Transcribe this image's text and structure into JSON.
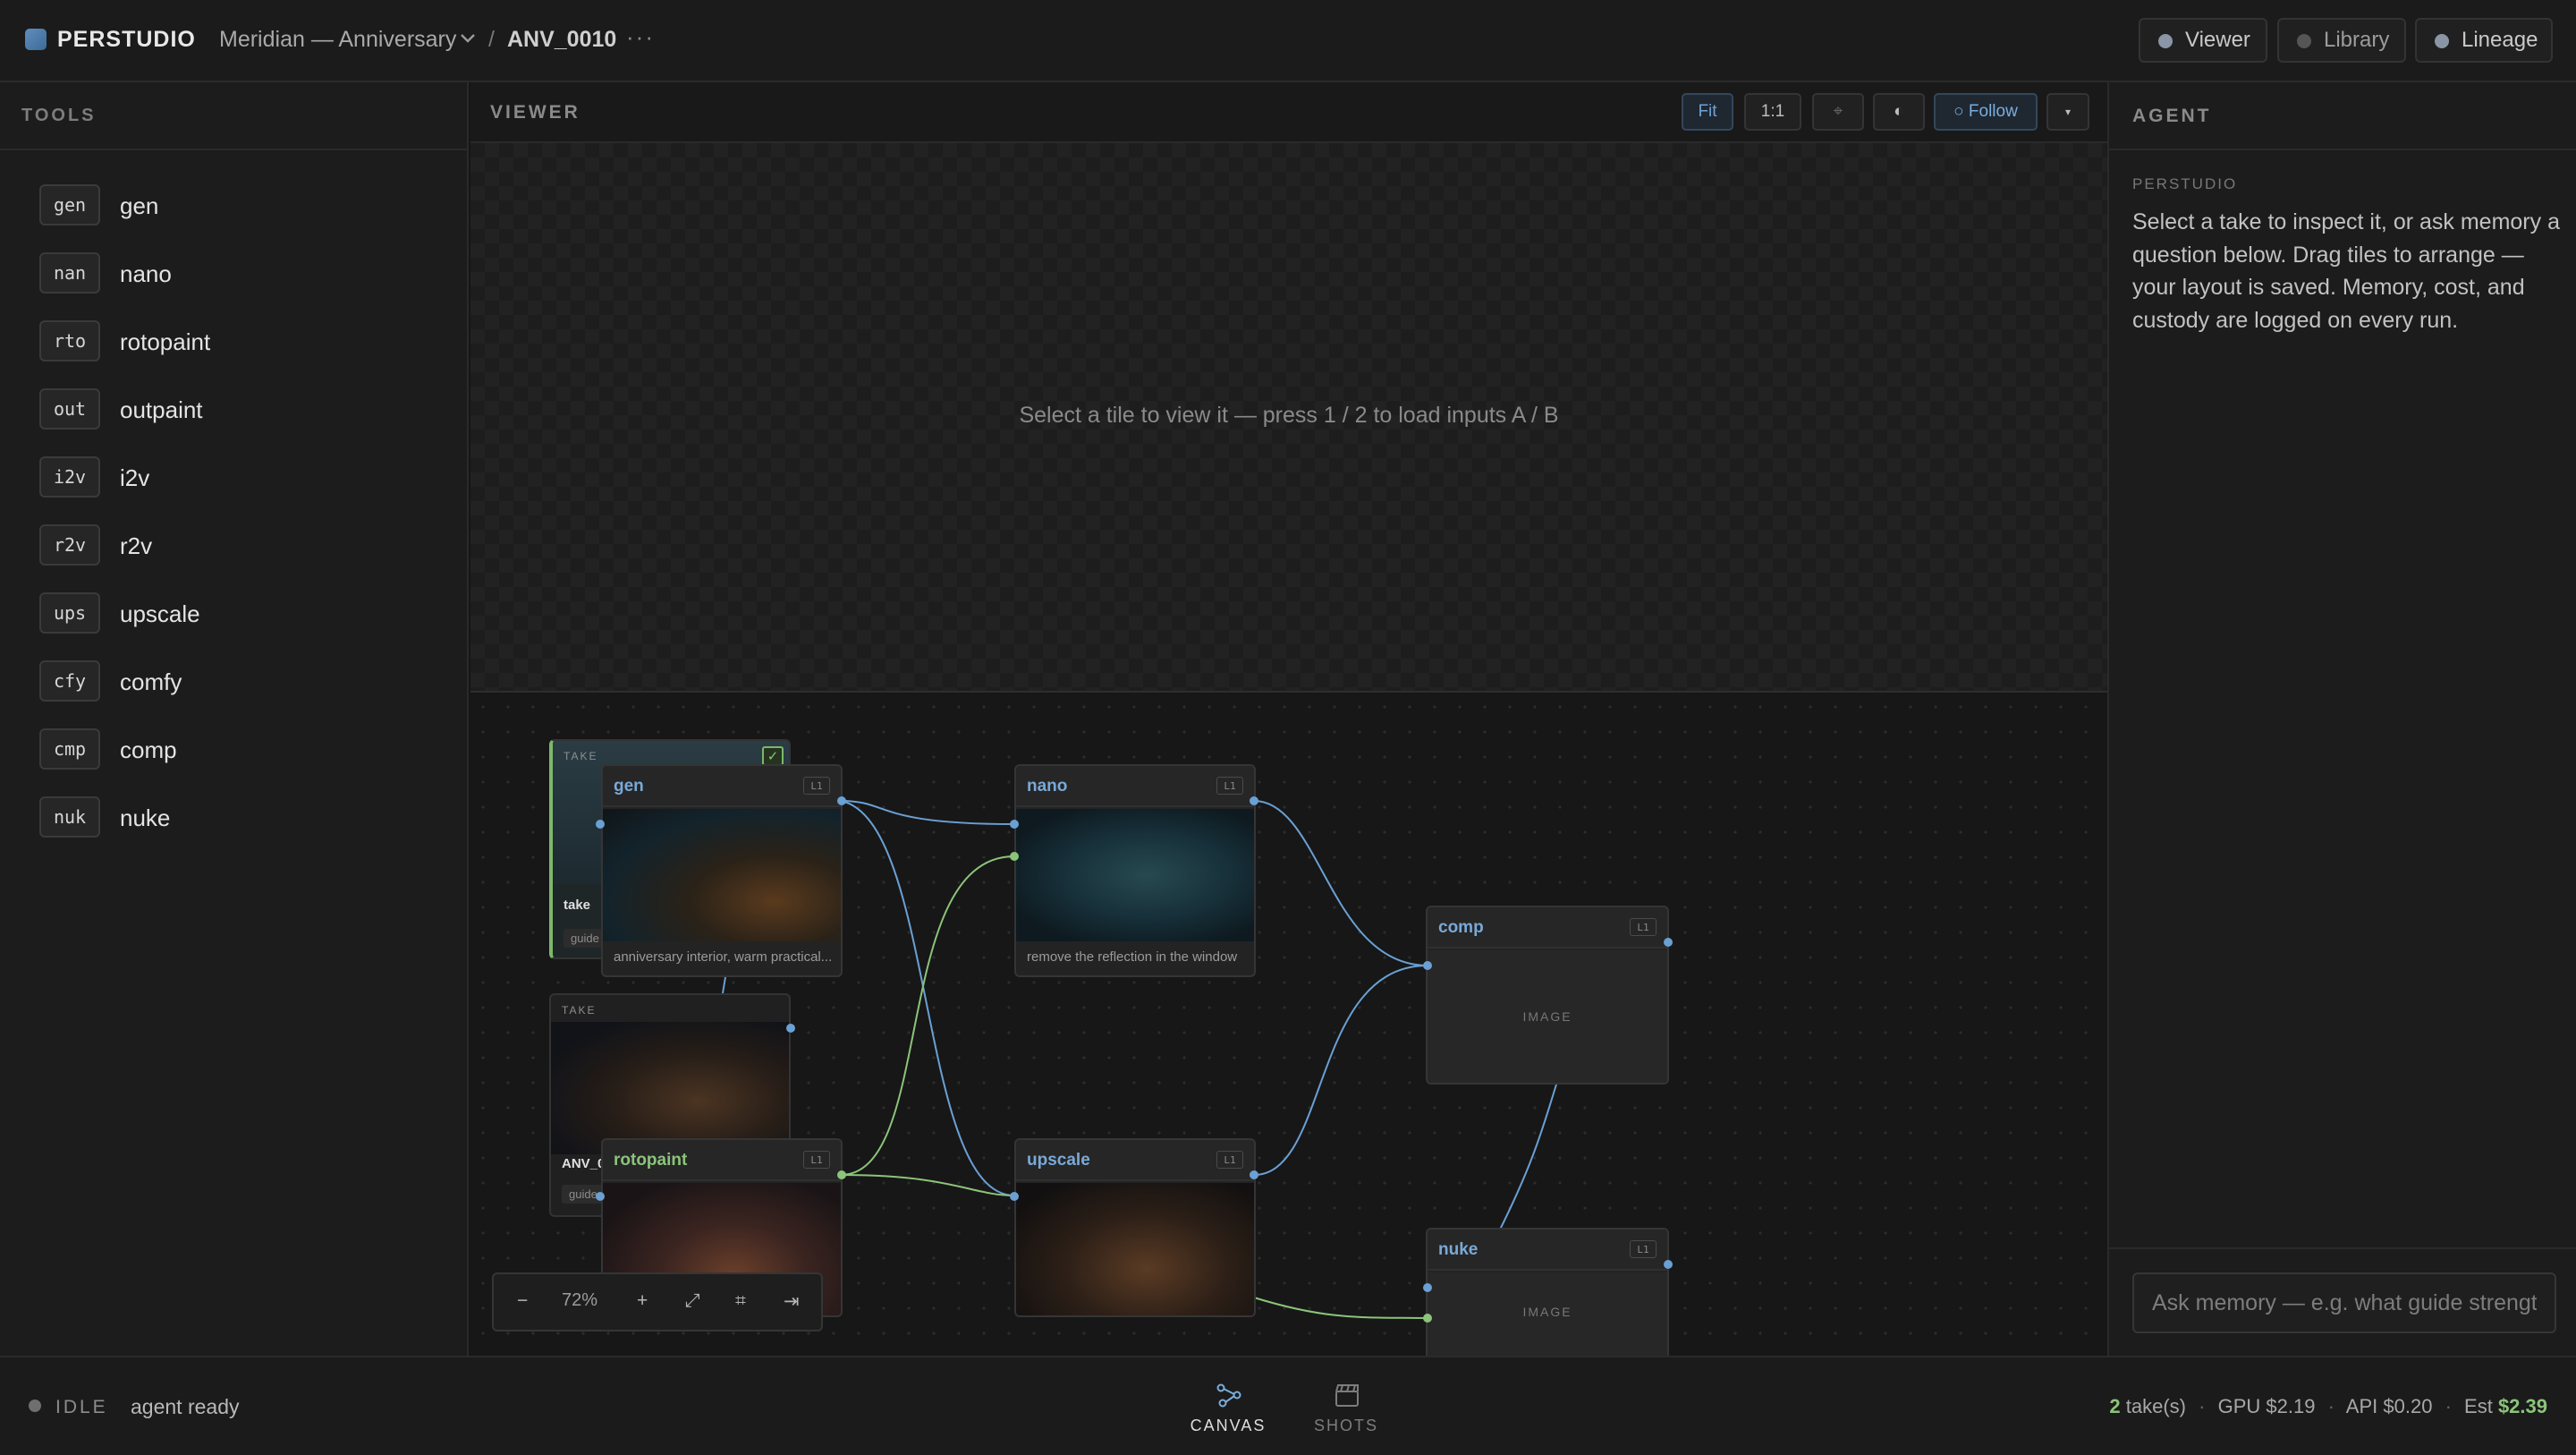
{
  "brand": {
    "name": "PERSTUDIO",
    "accent": "#4f83b8"
  },
  "breadcrumb": {
    "project": "Meridian — Anniversary",
    "separator": "/",
    "shot": "ANV_0010",
    "more": "···"
  },
  "top_tabs": [
    {
      "label": "Viewer"
    },
    {
      "label": "Library"
    },
    {
      "label": "Lineage"
    }
  ],
  "tools": {
    "title": "TOOLS",
    "items": [
      {
        "badge": "gen",
        "label": "gen"
      },
      {
        "badge": "nan",
        "label": "nano"
      },
      {
        "badge": "rto",
        "label": "rotopaint"
      },
      {
        "badge": "out",
        "label": "outpaint"
      },
      {
        "badge": "i2v",
        "label": "i2v"
      },
      {
        "badge": "r2v",
        "label": "r2v"
      },
      {
        "badge": "ups",
        "label": "upscale"
      },
      {
        "badge": "cfy",
        "label": "comfy"
      },
      {
        "badge": "cmp",
        "label": "comp"
      },
      {
        "badge": "nuk",
        "label": "nuke"
      }
    ]
  },
  "viewer": {
    "title": "VIEWER",
    "buttons": {
      "fit": "Fit",
      "one_to_one": "1:1",
      "crosshair": "⌖",
      "contrast": "◐",
      "follow": "○ Follow",
      "menu": "▾"
    },
    "hint": "Select a tile to view it — press 1 / 2 to load inputs A / B"
  },
  "canvas": {
    "takes": [
      {
        "label": "TAKE",
        "name": "take",
        "chip": "guide",
        "selected": true
      },
      {
        "label": "TAKE",
        "name": "ANV_0",
        "chip": "guide"
      }
    ],
    "nodes": {
      "gen": {
        "title": "gen",
        "level": "L1",
        "caption": "anniversary interior, warm practical..."
      },
      "nano": {
        "title": "nano",
        "level": "L1",
        "caption": "remove the reflection in the window"
      },
      "comp": {
        "title": "comp",
        "level": "L1",
        "placeholder": "IMAGE"
      },
      "rotopaint": {
        "title": "rotopaint",
        "level": "L1"
      },
      "upscale": {
        "title": "upscale",
        "level": "L1"
      },
      "nuke": {
        "title": "nuke",
        "level": "L1",
        "placeholder": "IMAGE"
      }
    },
    "zoom": {
      "minus": "−",
      "level": "72%",
      "plus": "+",
      "expand": "⤢",
      "grid": "⌗",
      "collapse": "⇥"
    }
  },
  "agent": {
    "title": "AGENT",
    "from": "PERSTUDIO",
    "message": "Select a take to inspect it, or ask memory a question below. Drag tiles to arrange — your layout is saved. Memory, cost, and custody are logged on every run.",
    "input_placeholder": "Ask memory — e.g. what guide strength"
  },
  "status": {
    "state": "IDLE",
    "message": "agent ready",
    "nav": [
      {
        "label": "CANVAS",
        "icon": "canvas-graph-icon"
      },
      {
        "label": "SHOTS",
        "icon": "clapperboard-icon"
      }
    ],
    "cost": {
      "takes_count": "2",
      "takes_suffix": "take(s)",
      "gpu": "GPU $2.19",
      "api": "API $0.20",
      "est_label": "Est",
      "est_value": "$2.39"
    }
  },
  "colors": {
    "link_blue": "#6aa0d4",
    "link_green": "#8cc47a",
    "background": "#161616"
  }
}
